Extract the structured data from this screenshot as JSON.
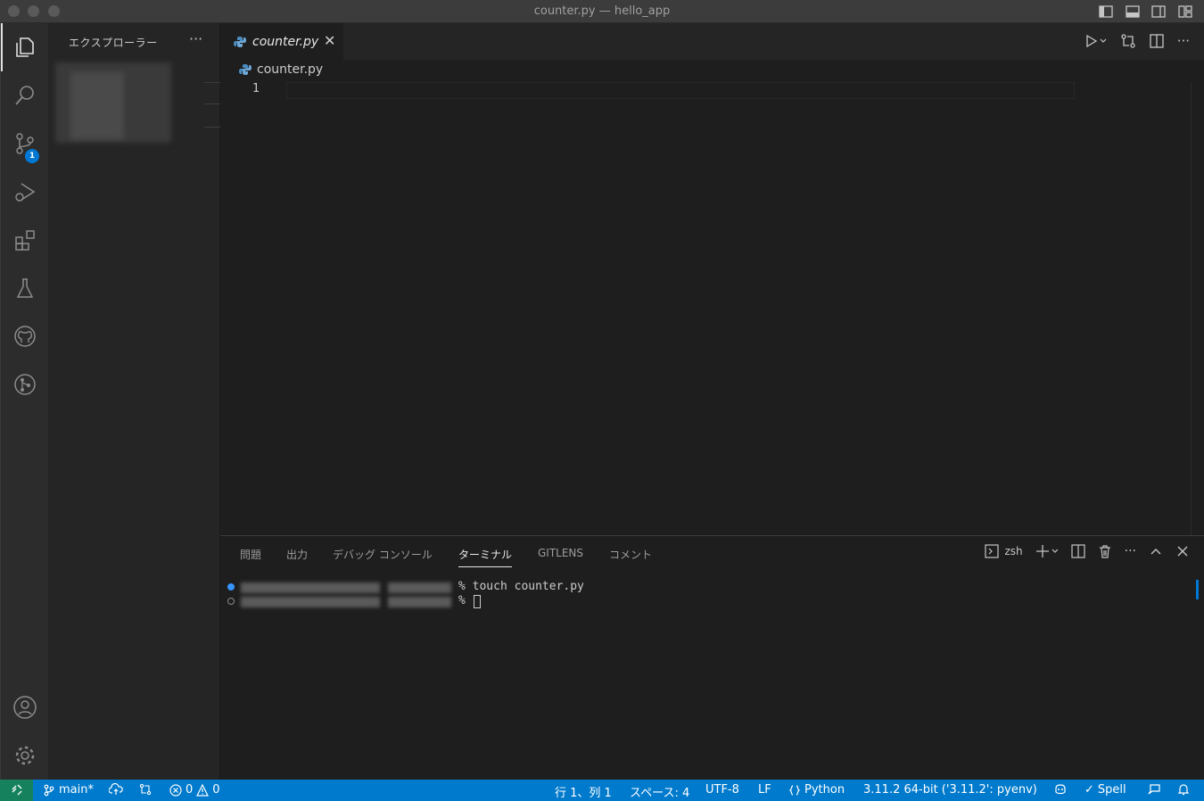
{
  "window": {
    "title": "counter.py — hello_app"
  },
  "activity_bar": {
    "scm_badge": "1"
  },
  "sidebar": {
    "title": "エクスプローラー",
    "more": "···"
  },
  "editor": {
    "tab_label": "counter.py",
    "breadcrumb": "counter.py",
    "line_number": "1"
  },
  "panel": {
    "tabs": [
      "問題",
      "出力",
      "デバッグ コンソール",
      "ターミナル",
      "GITLENS",
      "コメント"
    ],
    "active_tab": "ターミナル",
    "shell": "zsh",
    "terminal_lines": [
      "% touch counter.py",
      "%"
    ]
  },
  "status_bar": {
    "branch": "main*",
    "errors": "0",
    "warnings": "0",
    "position": "行 1、列 1",
    "spaces": "スペース: 4",
    "encoding": "UTF-8",
    "eol": "LF",
    "language": "Python",
    "interpreter": "3.11.2 64-bit ('3.11.2': pyenv)",
    "spell": "Spell"
  },
  "colors": {
    "accent": "#007acc",
    "remote": "#16825d",
    "background": "#1e1e1e"
  }
}
